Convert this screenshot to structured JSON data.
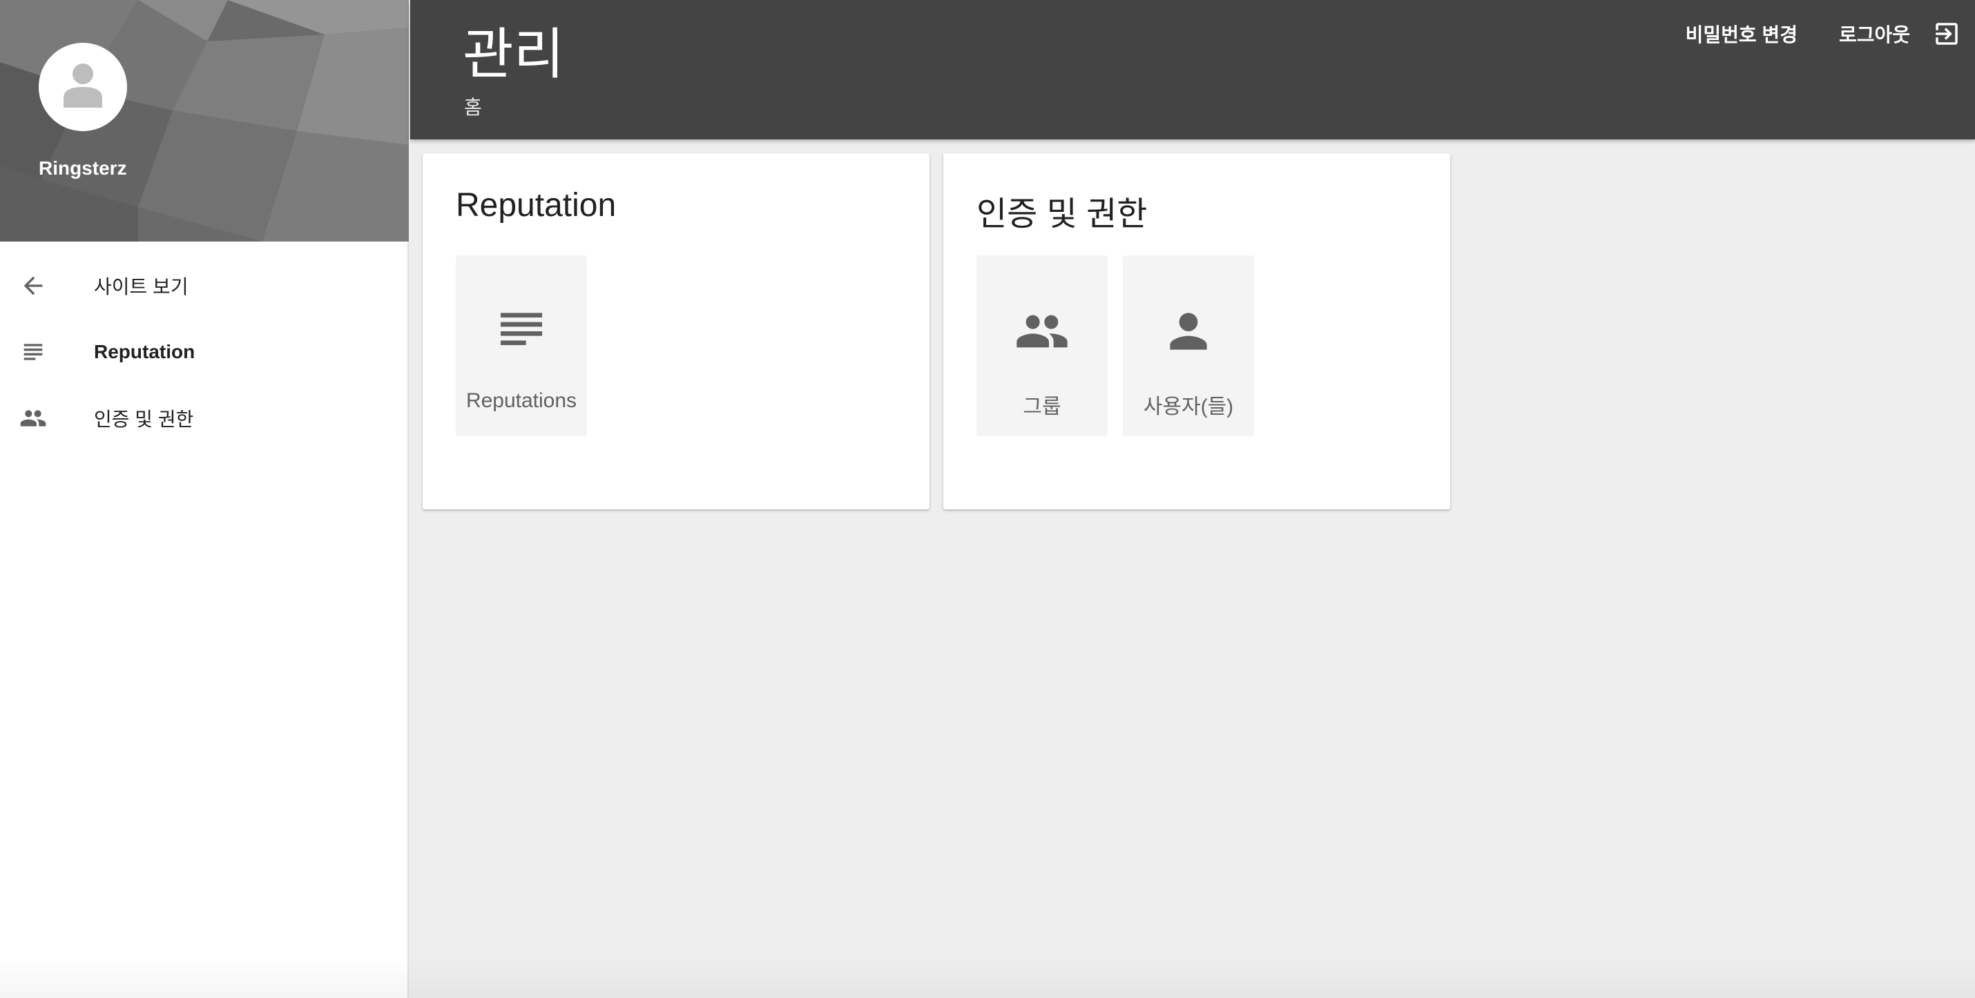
{
  "sidebar": {
    "username": "Ringsterz",
    "items": [
      {
        "label": "사이트 보기",
        "icon": "arrow-left-icon"
      },
      {
        "label": "Reputation",
        "icon": "list-icon"
      },
      {
        "label": "인증 및 권한",
        "icon": "people-icon"
      }
    ]
  },
  "header": {
    "title": "관리",
    "breadcrumb": "홈",
    "change_password": "비밀번호 변경",
    "logout": "로그아웃",
    "logout_icon": "logout-icon"
  },
  "cards": [
    {
      "title": "Reputation",
      "tiles": [
        {
          "label": "Reputations",
          "icon": "list-icon"
        }
      ]
    },
    {
      "title": "인증 및 권한",
      "tiles": [
        {
          "label": "그룹",
          "icon": "group-icon"
        },
        {
          "label": "사용자(들)",
          "icon": "person-icon"
        }
      ]
    }
  ],
  "colors": {
    "topbar": "#444444",
    "background": "#eeeeee",
    "icon": "#616161"
  }
}
